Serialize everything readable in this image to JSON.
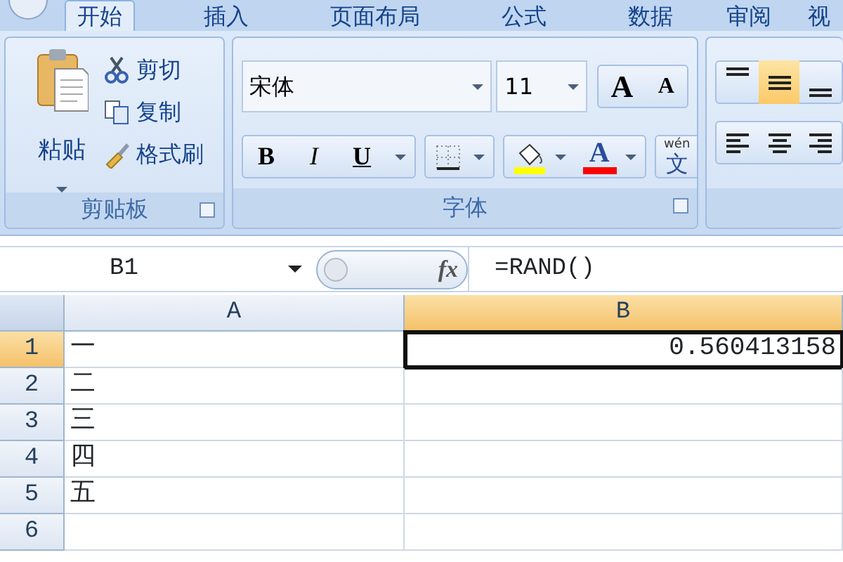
{
  "ribbon_tabs": [
    {
      "label": "开始",
      "selected": true
    },
    {
      "label": "插入",
      "selected": false
    },
    {
      "label": "页面布局",
      "selected": false
    },
    {
      "label": "公式",
      "selected": false
    },
    {
      "label": "数据",
      "selected": false
    },
    {
      "label": "审阅",
      "selected": false
    },
    {
      "label": "视",
      "selected": false
    }
  ],
  "clipboard_group": {
    "paste": "粘贴",
    "commands": [
      {
        "kind": "cut",
        "label": "剪切"
      },
      {
        "kind": "copy",
        "label": "复制"
      },
      {
        "kind": "brush",
        "label": "格式刷"
      }
    ],
    "label": "剪贴板"
  },
  "font_group": {
    "font_name": "宋体",
    "font_size": "11",
    "grow": "A",
    "shrink": "A",
    "style_buttons": [
      {
        "kind": "bold",
        "label": "B"
      },
      {
        "kind": "italic",
        "label": "I"
      },
      {
        "kind": "underline",
        "label": "U"
      }
    ],
    "font_color": "A",
    "phonetic_top": "wén",
    "phonetic_char": "文",
    "label": "字体"
  },
  "alignment_buttons": [
    {
      "kind": "top",
      "selected": false
    },
    {
      "kind": "middle",
      "selected": true
    },
    {
      "kind": "bottom",
      "selected": false
    },
    {
      "kind": "left",
      "selected": false
    },
    {
      "kind": "center",
      "selected": false
    },
    {
      "kind": "right",
      "selected": false
    }
  ],
  "formula_bar": {
    "name_box": "B1",
    "fx": "fx",
    "formula": "=RAND()"
  },
  "sheet": {
    "columns": [
      {
        "label": "A",
        "selected": false
      },
      {
        "label": "B",
        "selected": true
      }
    ],
    "rows": [
      {
        "header": "1",
        "selected": true,
        "cells": [
          {
            "text": "一",
            "selected": false
          },
          {
            "text": "0.560413158",
            "selected": true
          }
        ]
      },
      {
        "header": "2",
        "selected": false,
        "cells": [
          {
            "text": "二",
            "selected": false
          },
          {
            "text": "",
            "selected": false
          }
        ]
      },
      {
        "header": "3",
        "selected": false,
        "cells": [
          {
            "text": "三",
            "selected": false
          },
          {
            "text": "",
            "selected": false
          }
        ]
      },
      {
        "header": "4",
        "selected": false,
        "cells": [
          {
            "text": "四",
            "selected": false
          },
          {
            "text": "",
            "selected": false
          }
        ]
      },
      {
        "header": "5",
        "selected": false,
        "cells": [
          {
            "text": "五",
            "selected": false
          },
          {
            "text": "",
            "selected": false
          }
        ]
      },
      {
        "header": "6",
        "selected": false,
        "cells": [
          {
            "text": "",
            "selected": false
          },
          {
            "text": "",
            "selected": false
          }
        ]
      }
    ]
  }
}
